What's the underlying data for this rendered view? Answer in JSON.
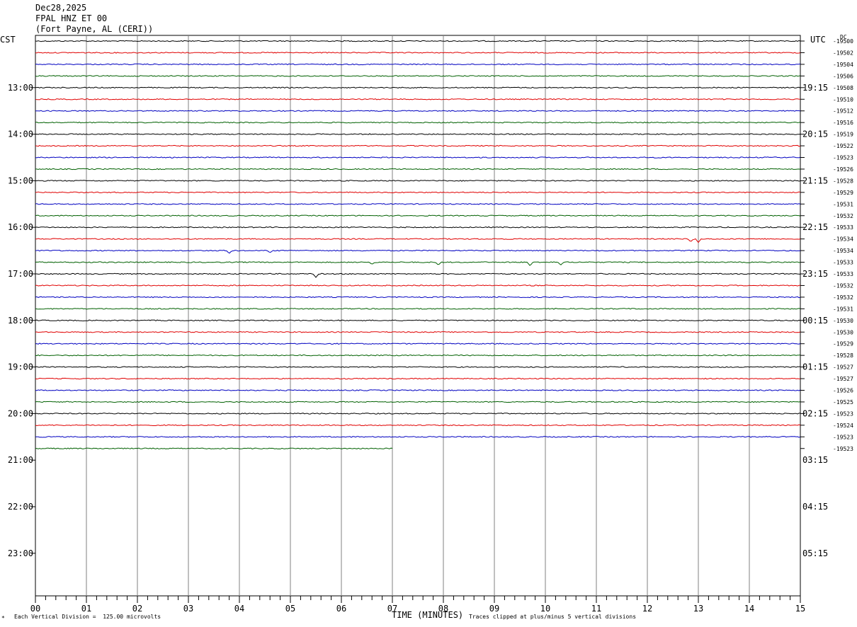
{
  "header": {
    "date": "Dec28,2025",
    "station": "FPAL HNZ ET 00",
    "location": "(Fort Payne, AL (CERI))"
  },
  "left_tz": "CST",
  "right_tz": "UTC",
  "dc_label": "DC",
  "footer": {
    "vertical_division": "Each Vertical Division =  125.00 microvolts",
    "clipping": "Traces clipped at plus/minus 5 vertical divisions",
    "corner_mark": "*"
  },
  "chart_data": {
    "type": "line",
    "title": "",
    "xlabel": "TIME (MINUTES)",
    "x_ticks": [
      "00",
      "01",
      "02",
      "03",
      "04",
      "05",
      "06",
      "07",
      "08",
      "09",
      "10",
      "11",
      "12",
      "13",
      "14",
      "15"
    ],
    "xlim": [
      0,
      15
    ],
    "left_hour_labels": [
      "13:00",
      "14:00",
      "15:00",
      "16:00",
      "17:00",
      "18:00",
      "19:00",
      "20:00",
      "21:00",
      "22:00",
      "23:00"
    ],
    "right_hour_labels": [
      "19:15",
      "20:15",
      "21:15",
      "22:15",
      "23:15",
      "00:15",
      "01:15",
      "02:15",
      "03:15",
      "04:15",
      "05:15"
    ],
    "trace_colors": [
      "#000000",
      "#e00000",
      "#0000c0",
      "#006000"
    ],
    "dc_offsets": [
      "-19500",
      "-19502",
      "-19504",
      "-19506",
      "-19508",
      "-19510",
      "-19512",
      "-19516",
      "-19519",
      "-19522",
      "-19523",
      "-19526",
      "-19528",
      "-19529",
      "-19531",
      "-19532",
      "-19533",
      "-19534",
      "-19534",
      "-19533",
      "-19533",
      "-19532",
      "-19532",
      "-19531",
      "-19530",
      "-19530",
      "-19529",
      "-19528",
      "-19527",
      "-19527",
      "-19526",
      "-19525",
      "-19523",
      "-19524",
      "-19523",
      "-19523"
    ],
    "trace_count": 36,
    "last_trace_end_minute": 7,
    "events": [
      {
        "trace": 17,
        "minute": 12.85,
        "depth": 4
      },
      {
        "trace": 17,
        "minute": 13.0,
        "depth": 5
      },
      {
        "trace": 18,
        "minute": 3.8,
        "depth": 4
      },
      {
        "trace": 18,
        "minute": 4.6,
        "depth": 3
      },
      {
        "trace": 19,
        "minute": 6.6,
        "depth": 3
      },
      {
        "trace": 19,
        "minute": 7.9,
        "depth": 4
      },
      {
        "trace": 19,
        "minute": 9.7,
        "depth": 5
      },
      {
        "trace": 19,
        "minute": 10.3,
        "depth": 4
      },
      {
        "trace": 20,
        "minute": 5.5,
        "depth": 5
      }
    ]
  }
}
